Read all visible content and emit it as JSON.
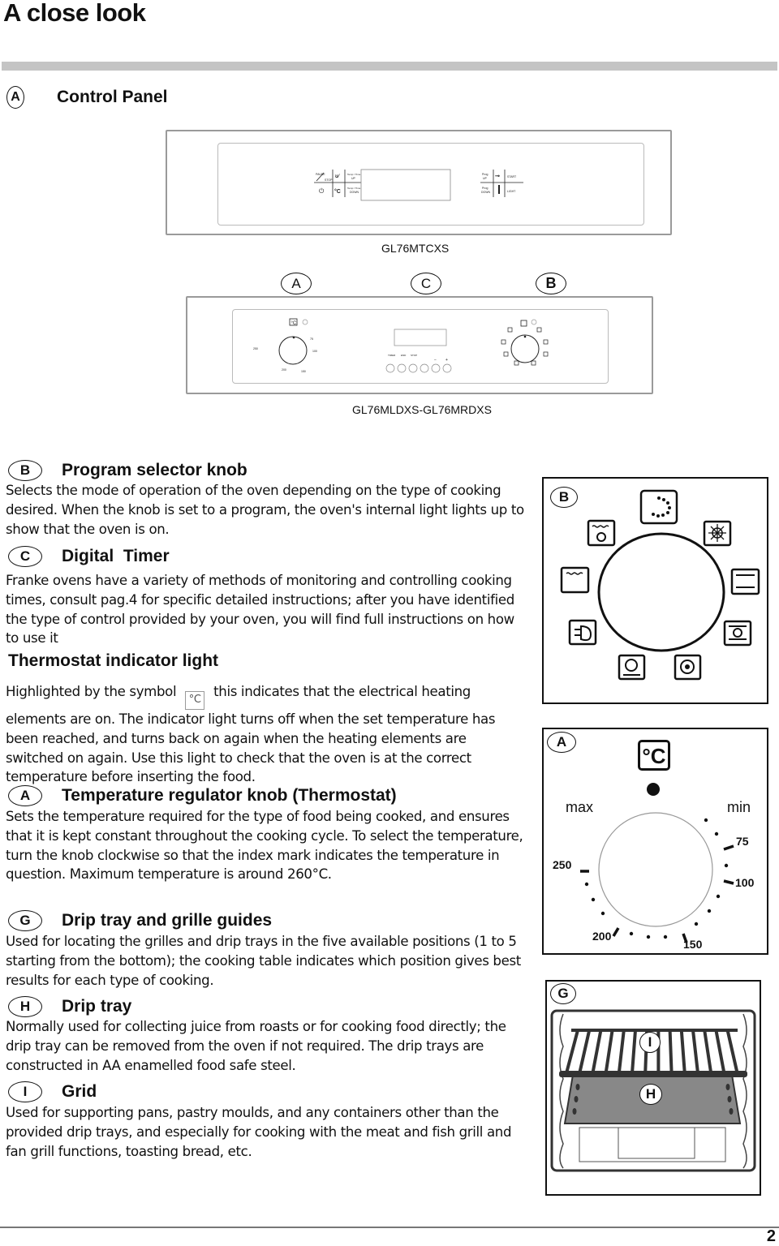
{
  "page": {
    "title": "A close look",
    "page_number": "2"
  },
  "control_panel": {
    "marker": "A",
    "heading": "Control Panel",
    "panel1": {
      "model": "GL76MTCXS",
      "left_keys": [
        "PAUSE / STOP",
        "Temp / Time UP",
        "Temp / Time DOWN",
        "°C"
      ],
      "right_keys": [
        "Prog UP",
        "Prog DOWN",
        "START",
        "LIGHT"
      ]
    },
    "panel2": {
      "model": "GL76MLDXS-GL76MRDXS",
      "callouts": [
        "A",
        "C",
        "B"
      ],
      "thermostat_scale": [
        "250",
        "75",
        "100",
        "200",
        "150"
      ],
      "timer_labels": [
        "TIMER",
        "END",
        "STOP",
        "",
        "−",
        "+"
      ]
    }
  },
  "sections": [
    {
      "marker": "B",
      "heading": "Program selector knob",
      "text": "Selects the mode of operation of the oven depending on the type of cooking desired. When the knob is set to a program, the oven's internal light lights up to show that the oven is on."
    },
    {
      "marker": "C",
      "heading": "Digital  Timer",
      "text": "Franke ovens have a variety of methods of monitoring and controlling cooking times, consult pag.4 for specific detailed instructions; after you have identified the type of control provided by your oven, you will find full instructions on how to use it"
    },
    {
      "marker": "",
      "heading": "Thermostat indicator light",
      "text_before_symbol": "Highlighted by the symbol",
      "symbol": "°C",
      "text_after_symbol": "this indicates that the electrical heating elements are on. The indicator light turns off when the set temperature has been reached, and turns back on again when the heating elements are switched on again. Use this light to check that the oven is at the correct temperature before inserting the food."
    },
    {
      "marker": "A",
      "heading": "Temperature regulator knob (Thermostat)",
      "text": "Sets the temperature required for the type of food being cooked, and ensures that it is kept constant throughout the cooking cycle. To select the temperature, turn the knob clockwise so that the index mark indicates the temperature in question. Maximum temperature is around 260°C."
    },
    {
      "marker": "G",
      "heading": "Drip tray and grille guides",
      "text": "Used for locating the grilles and drip trays in the five available positions (1 to 5 starting from the bottom); the cooking table indicates which position gives best results for each type of cooking."
    },
    {
      "marker": "H",
      "heading": "Drip tray",
      "text": "Normally used for collecting juice from roasts or for cooking food directly; the drip tray can be removed from the oven if not required. The drip trays are constructed in AA enamelled food safe steel."
    },
    {
      "marker": "I",
      "heading": "Grid",
      "text": "Used for supporting pans, pastry moulds, and any containers other than the provided drip trays, and especially for cooking with the meat and fish grill and fan grill functions, toasting bread, etc."
    }
  ],
  "diagrams": {
    "program_knob": {
      "marker": "B",
      "icons": [
        "defrost-dots-icon",
        "top-heat-fan-icon",
        "light-icon",
        "top-element-icon",
        "top-bottom-element-icon",
        "grill-fan-icon",
        "fan-bottom-icon",
        "bottom-fan-icon",
        "fan-icon"
      ]
    },
    "thermostat_knob": {
      "marker": "A",
      "symbol": "°C",
      "max_label": "max",
      "min_label": "min",
      "scale": [
        {
          "label": "75"
        },
        {
          "label": "100"
        },
        {
          "label": "150"
        },
        {
          "label": "200"
        },
        {
          "label": "250"
        }
      ]
    },
    "oven_interior": {
      "marker_guides": "G",
      "marker_grid": "I",
      "marker_tray": "H"
    }
  }
}
